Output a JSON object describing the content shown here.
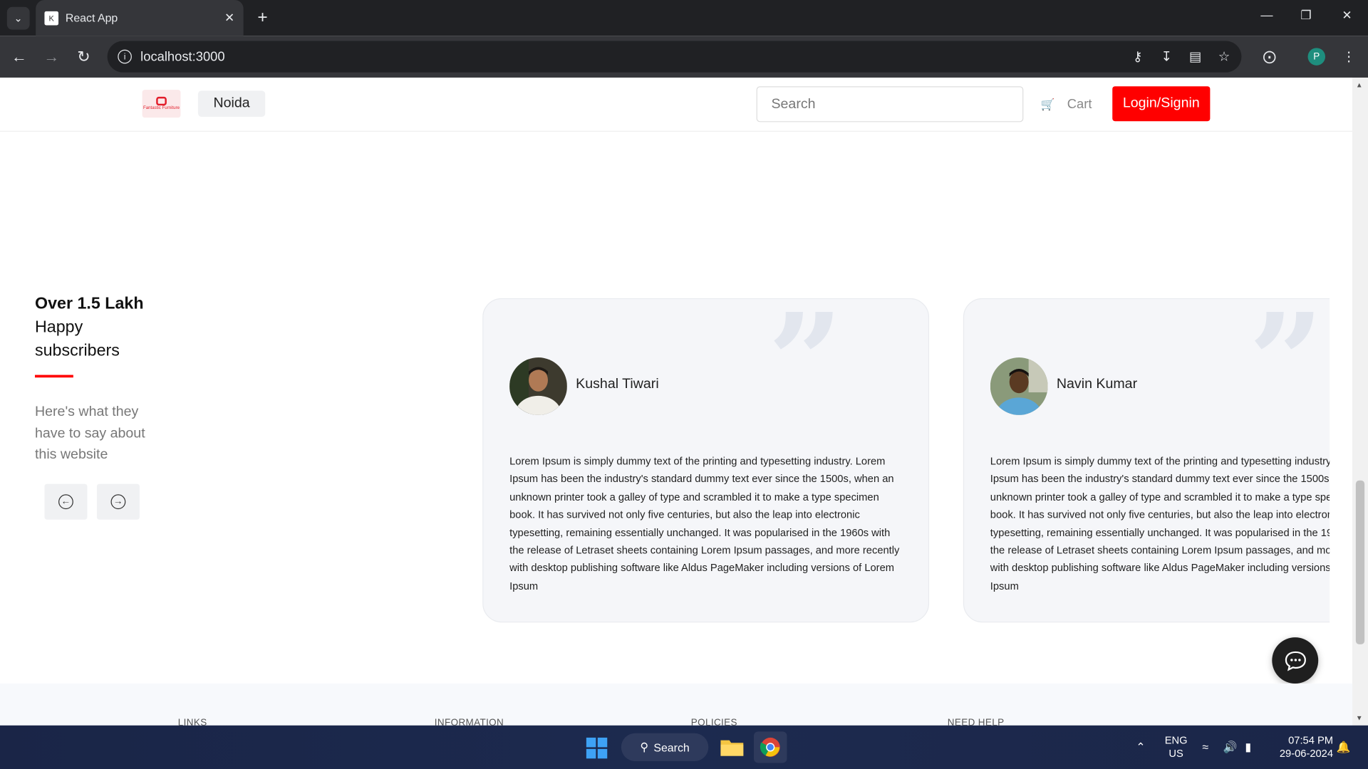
{
  "browser": {
    "tab_title": "React App",
    "url": "localhost:3000",
    "profile_initial": "P"
  },
  "header": {
    "location": "Noida",
    "search_placeholder": "Search",
    "cart_label": "Cart",
    "login_label": "Login/Signin",
    "logo_text": "Fantastic Furniture",
    "accent_color": "#ff0000"
  },
  "testimonials": {
    "stat_bold": "Over 1.5 Lakh",
    "stat_line2": "Happy",
    "stat_line3": "subscribers",
    "subtitle": "Here's what they have to say about this website",
    "cards": [
      {
        "name": "Kushal Tiwari",
        "text": "Lorem Ipsum is simply dummy text of the printing and typesetting industry. Lorem Ipsum has been the industry's standard dummy text ever since the 1500s, when an unknown printer took a galley of type and scrambled it to make a type specimen book. It has survived not only five centuries, but also the leap into electronic typesetting, remaining essentially unchanged. It was popularised in the 1960s with the release of Letraset sheets containing Lorem Ipsum passages, and more recently with desktop publishing software like Aldus PageMaker including versions of Lorem Ipsum"
      },
      {
        "name": "Navin Kumar",
        "text": "Lorem Ipsum is simply dummy text of the printing and typesetting industry. Lorem Ipsum has been the industry's standard dummy text ever since the 1500s, when an unknown printer took a galley of type and scrambled it to make a type specimen book. It has survived not only five centuries, but also the leap into electronic typesetting, remaining essentially unchanged. It was popularised in the 1960s with the release of Letraset sheets containing Lorem Ipsum passages, and more recently with desktop publishing software like Aldus PageMaker including versions of Lorem Ipsum"
      }
    ]
  },
  "footer": {
    "headings": [
      "LINKS",
      "INFORMATION",
      "POLICIES",
      "NEED HELP"
    ]
  },
  "taskbar": {
    "search_label": "Search",
    "lang": "ENG",
    "region": "US",
    "time": "07:54 PM",
    "date": "29-06-2024"
  }
}
